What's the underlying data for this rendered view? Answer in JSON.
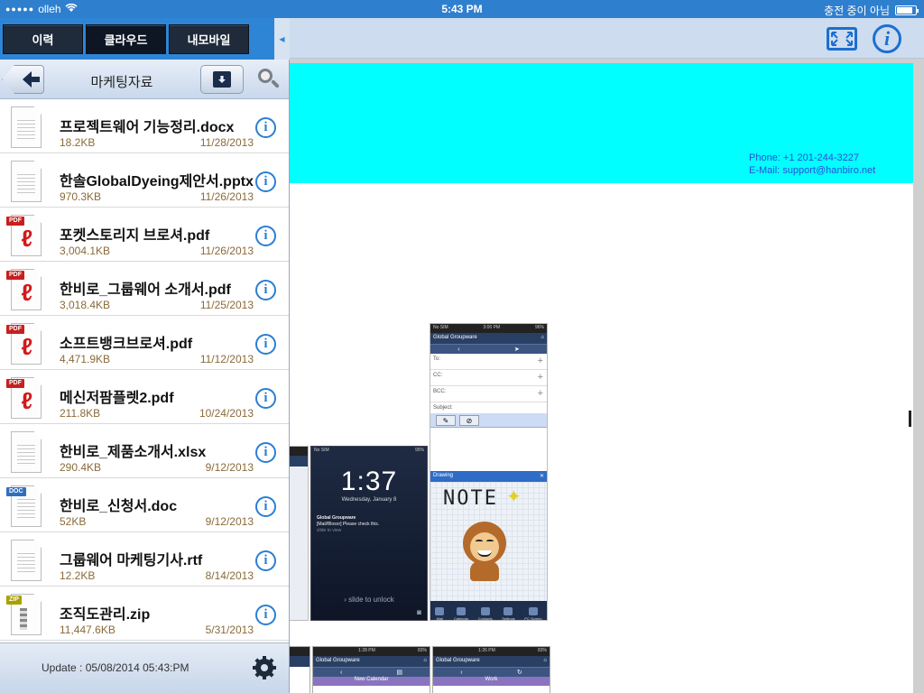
{
  "status_bar": {
    "carrier": "olleh",
    "time": "5:43 PM",
    "charge_status": "충전 중이 아님",
    "battery_level": 0.85
  },
  "panel": {
    "tabs": [
      {
        "label": "이력"
      },
      {
        "label": "클라우드"
      },
      {
        "label": "내모바일"
      }
    ],
    "active_tab": 1,
    "folder_title": "마케팅자료",
    "files": [
      {
        "name": "프로젝트웨어 기능정리.docx",
        "size": "18.2KB",
        "date": "11/28/2013",
        "type": "generic"
      },
      {
        "name": "한솔GlobalDyeing제안서.pptx",
        "size": "970.3KB",
        "date": "11/26/2013",
        "type": "generic"
      },
      {
        "name": "포켓스토리지 브로셔.pdf",
        "size": "3,004.1KB",
        "date": "11/26/2013",
        "type": "pdf"
      },
      {
        "name": "한비로_그룹웨어 소개서.pdf",
        "size": "3,018.4KB",
        "date": "11/25/2013",
        "type": "pdf"
      },
      {
        "name": "소프트뱅크브로셔.pdf",
        "size": "4,471.9KB",
        "date": "11/12/2013",
        "type": "pdf"
      },
      {
        "name": "메신저팜플렛2.pdf",
        "size": "211.8KB",
        "date": "10/24/2013",
        "type": "pdf"
      },
      {
        "name": "한비로_제품소개서.xlsx",
        "size": "290.4KB",
        "date": "9/12/2013",
        "type": "generic"
      },
      {
        "name": "한비로_신청서.doc",
        "size": "52KB",
        "date": "9/12/2013",
        "type": "doc"
      },
      {
        "name": "그룹웨어 마케팅기사.rtf",
        "size": "12.2KB",
        "date": "8/14/2013",
        "type": "generic"
      },
      {
        "name": "조직도관리.zip",
        "size": "11,447.6KB",
        "date": "5/31/2013",
        "type": "zip"
      }
    ],
    "file_tags": {
      "pdf": "PDF",
      "doc": "DOC",
      "zip": "ZIP"
    },
    "update_text": "Update : 05/08/2014 05:43:PM"
  },
  "viewer": {
    "contact_phone": "Phone: +1 201-244-3227",
    "contact_email": "E-Mail: support@hanbiro.net",
    "banner_color": "#00ffff",
    "compose_shot": {
      "status_left": "No SIM",
      "status_time": "3:00 PM",
      "status_right": "96%",
      "header": "Global Groupware",
      "fields": [
        "To:",
        "CC:",
        "BCC:",
        "Subject:"
      ],
      "drawing_label": "Drawing",
      "note_text": "NOTE",
      "tabs": [
        "Mail",
        "Calendar",
        "Contacts",
        "Settings",
        "PC Screen"
      ]
    },
    "lock_shot": {
      "status_left": "No SIM",
      "status_right": "95%",
      "time": "1:37",
      "date": "Wednesday, January 8",
      "notif_title": "Global Groupware",
      "notif_body": "[Mail/Blosor] Please check this.",
      "notif_hint": "slide to view",
      "unlock": "slide to unlock"
    },
    "bottom_shots": [
      {
        "time": "1:28 PM",
        "battery": "83%",
        "header": "Global Groupware",
        "bar": "New Calendar"
      },
      {
        "time": "1:26 PM",
        "battery": "83%",
        "header": "Global Groupware",
        "bar": "Work"
      }
    ]
  },
  "colors": {
    "accent": "#2e85d6",
    "icon_blue": "#1c6ed1",
    "pdf_red": "#c71f1f"
  }
}
